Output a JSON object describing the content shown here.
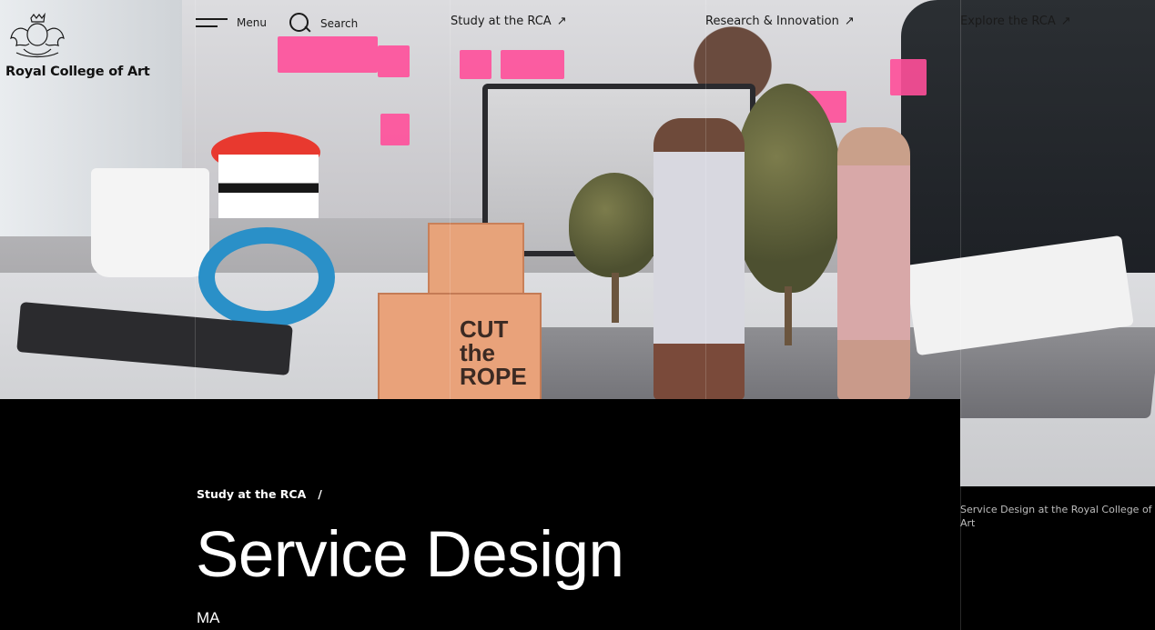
{
  "header": {
    "logo_text": "Royal College of Art",
    "menu_label": "Menu",
    "search_label": "Search",
    "nav": [
      {
        "label": "Study at the RCA",
        "icon": "arrow-up-right-icon"
      },
      {
        "label": "Research & Innovation",
        "icon": "arrow-up-right-icon"
      },
      {
        "label": "Explore the RCA",
        "icon": "arrow-up-right-icon"
      }
    ]
  },
  "hero": {
    "box_text": "CUT the ROPE"
  },
  "main": {
    "breadcrumb": {
      "item": "Study at the RCA",
      "separator": "/"
    },
    "title": "Service Design",
    "degree": "MA",
    "image_caption": "Service Design at the Royal College of Art"
  },
  "colors": {
    "background": "#000000",
    "text": "#ffffff",
    "header_text": "#1a1a1a",
    "caption_text": "#bdbdbd"
  }
}
